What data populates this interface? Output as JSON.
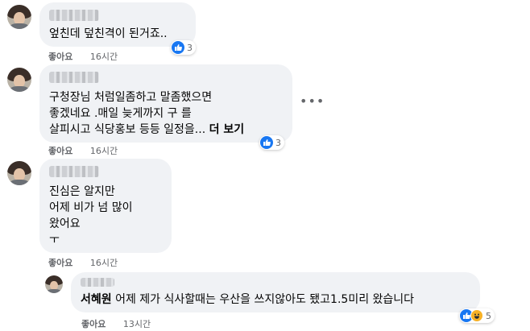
{
  "comments": [
    {
      "text": "엎친데 덮친격이 된거죠..",
      "like_label": "좋아요",
      "time": "16시간",
      "reaction_count": "3"
    },
    {
      "text": "구청장님 처럼일좀하고 말좀했으면\n좋겠네요 .매일 늦게까지 구 를\n살피시고 식당홍보 등등 일정을...",
      "more_label": "더 보기",
      "like_label": "좋아요",
      "time": "16시간",
      "reaction_count": "3"
    },
    {
      "text": "진심은 알지만\n어제 비가 넘 많이\n왔어요\nㅜ",
      "like_label": "좋아요",
      "time": "16시간"
    }
  ],
  "reply": {
    "author": "서혜원",
    "text": " 어제 제가 식사할때는 우산을 쓰지않아도 됐고1.5미리 왔습니다",
    "like_label": "좋아요",
    "time": "13시간",
    "reaction_count": "5"
  },
  "more_options_icon": "more-horizontal-icon",
  "reaction_icons": [
    "like-icon",
    "haha-icon"
  ],
  "colors": {
    "bubble": "#f0f2f5",
    "like_blue": "#1877f2",
    "meta_text": "#65676b"
  }
}
